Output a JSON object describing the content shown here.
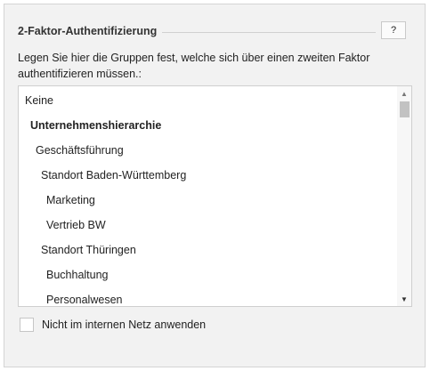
{
  "section": {
    "title": "2-Faktor-Authentifizierung",
    "help_label": "?",
    "description": "Legen Sie hier die Gruppen fest, welche sich über einen zweiten Faktor authentifizieren müssen.:"
  },
  "group_list": {
    "items": [
      {
        "label": "Keine",
        "level": 0,
        "bold": false
      },
      {
        "label": "Unternehmenshierarchie",
        "level": 1,
        "bold": true
      },
      {
        "label": "Geschäftsführung",
        "level": 2,
        "bold": false
      },
      {
        "label": "Standort Baden-Württemberg",
        "level": 3,
        "bold": false
      },
      {
        "label": "Marketing",
        "level": 4,
        "bold": false
      },
      {
        "label": "Vertrieb BW",
        "level": 4,
        "bold": false
      },
      {
        "label": "Standort Thüringen",
        "level": 3,
        "bold": false
      },
      {
        "label": "Buchhaltung",
        "level": 4,
        "bold": false
      },
      {
        "label": "Personalwesen",
        "level": 4,
        "bold": false
      }
    ],
    "scroll_position": 0.0
  },
  "options": {
    "internal_network_label": "Nicht im internen Netz anwenden",
    "internal_network_checked": false
  },
  "colors": {
    "panel_background": "#f2f2f2",
    "list_background": "#ffffff",
    "border": "#cfcfcf",
    "text": "#222222"
  }
}
